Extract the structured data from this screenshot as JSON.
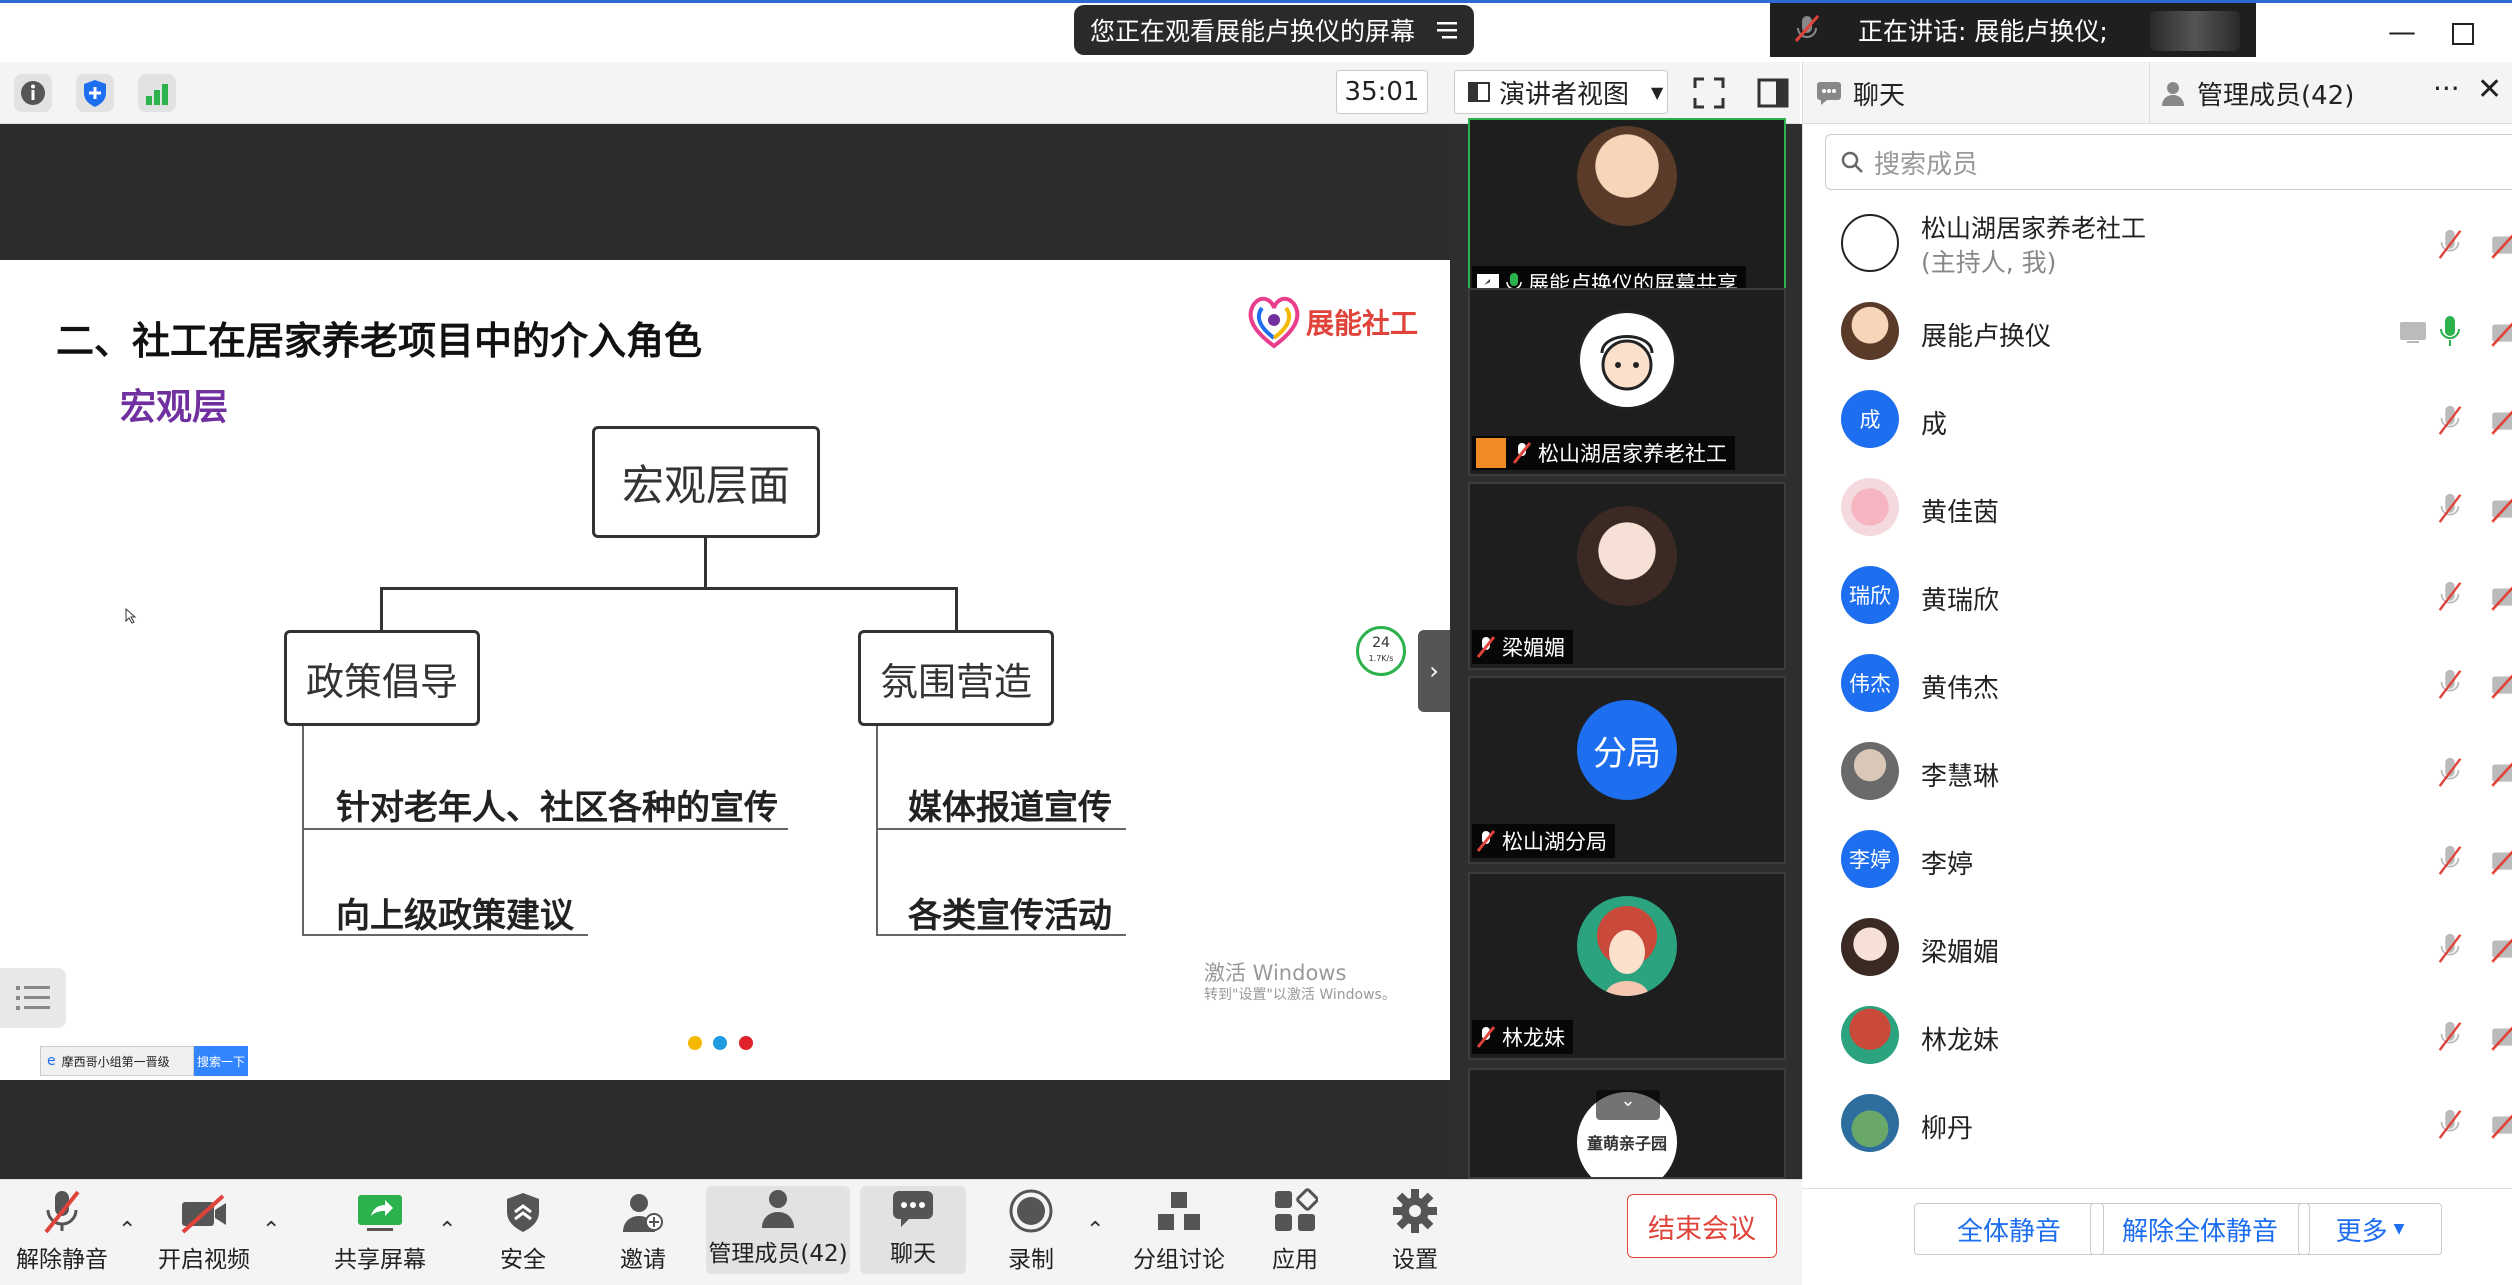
{
  "window": {
    "minimize_icon": "minimize-icon",
    "maximize_icon": "maximize-icon"
  },
  "sharing_banner": {
    "text": "您正在观看展能卢换仪的屏幕"
  },
  "speaking": {
    "text": "正在讲话: 展能卢换仪;"
  },
  "toolbar": {
    "timer": "35:01",
    "view_mode": "演讲者视图"
  },
  "panel_tabs": {
    "chat": "聊天",
    "members": "管理成员(42)"
  },
  "slide": {
    "title": "二、社工在居家养老项目中的介入角色",
    "subtitle": "宏观层",
    "logo_text": "展能社工",
    "root": "宏观层面",
    "left_branch": "政策倡导",
    "right_branch": "氛围营造",
    "left_items": [
      "针对老年人、社区各种的宣传",
      "向上级政策建议"
    ],
    "right_items": [
      "媒体报道宣传",
      "各类宣传活动"
    ],
    "activate_title": "激活 Windows",
    "activate_sub": "转到\"设置\"以激活 Windows。",
    "taskbar_text": "摩西哥小组第一晋级",
    "taskbar_btn": "搜索一下",
    "net_percent": "24",
    "net_speed": "1.7K/s"
  },
  "thumbnails": [
    {
      "name": "展能卢换仪的屏幕共享"
    },
    {
      "name": "松山湖居家养老社工"
    },
    {
      "name": "梁媚媚"
    },
    {
      "name": "松山湖分局",
      "avatar_text": "分局"
    },
    {
      "name": "林龙妹"
    },
    {
      "name": "童萌亲子园"
    }
  ],
  "members_panel": {
    "search_placeholder": "搜索成员",
    "members": [
      {
        "name": "松山湖居家养老社工",
        "note": "(主持人, 我)"
      },
      {
        "name": "展能卢换仪"
      },
      {
        "name": "成",
        "avatar_text": "成"
      },
      {
        "name": "黄佳茵"
      },
      {
        "name": "黄瑞欣",
        "avatar_text": "瑞欣"
      },
      {
        "name": "黄伟杰",
        "avatar_text": "伟杰"
      },
      {
        "name": "李慧琳"
      },
      {
        "name": "李婷",
        "avatar_text": "李婷"
      },
      {
        "name": "梁媚媚"
      },
      {
        "name": "林龙妹"
      },
      {
        "name": "柳丹"
      }
    ],
    "mute_all": "全体静音",
    "unmute_all": "解除全体静音",
    "more": "更多"
  },
  "bottom_bar": {
    "unmute": "解除静音",
    "start_video": "开启视频",
    "share": "共享屏幕",
    "security": "安全",
    "invite": "邀请",
    "manage": "管理成员(42)",
    "chat": "聊天",
    "record": "录制",
    "breakout": "分组讨论",
    "apps": "应用",
    "settings": "设置",
    "end": "结束会议"
  },
  "colors": {
    "accent": "#1e6ef0",
    "end": "#e0433a",
    "subtitle": "#7030a0"
  }
}
